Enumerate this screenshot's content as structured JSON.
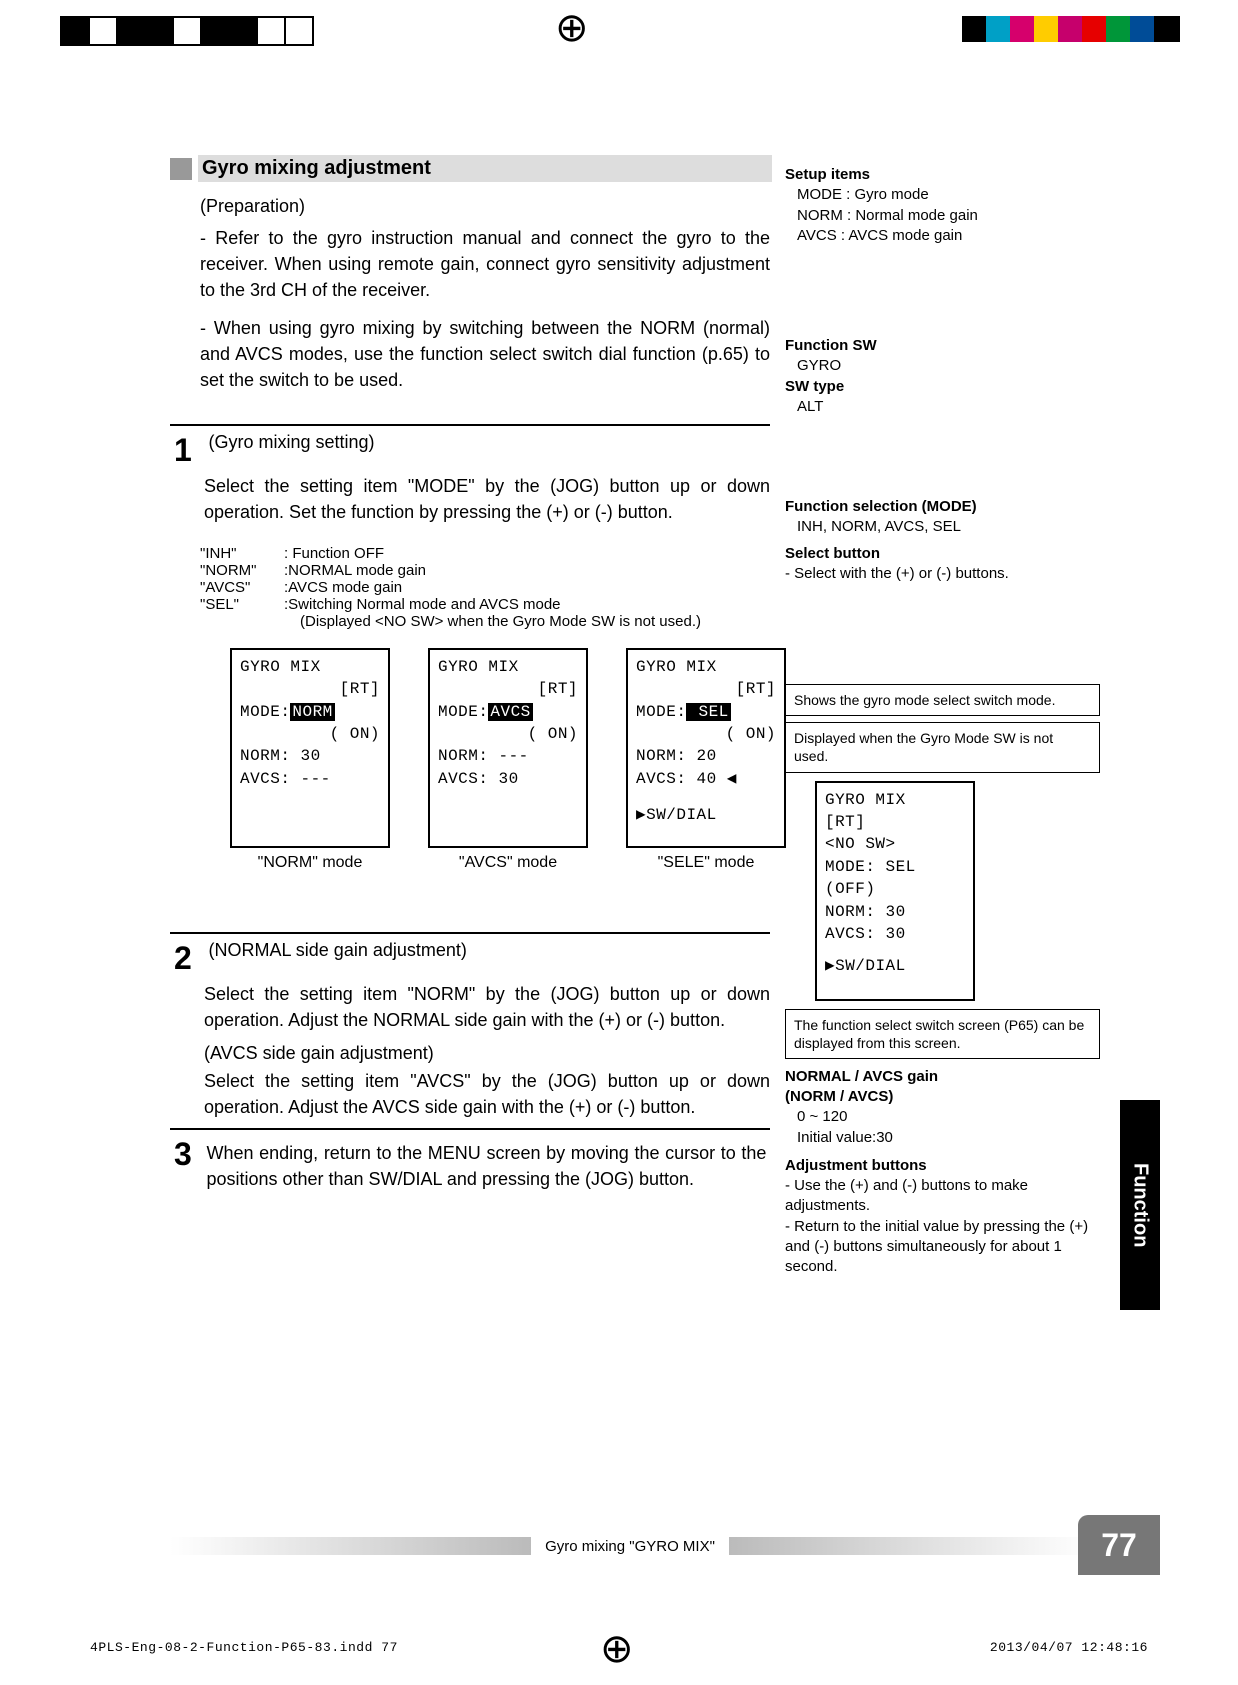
{
  "header": {
    "title": "Gyro mixing adjustment"
  },
  "prep": {
    "label": "(Preparation)",
    "p1": "- Refer to the gyro instruction manual and connect the gyro to the receiver. When using remote gain, connect gyro sensitivity adjustment to the 3rd CH of the receiver.",
    "p2": "- When using gyro mixing by switching between the NORM (normal) and AVCS modes, use the function select switch dial function (p.65) to set the switch to be used."
  },
  "step1": {
    "title": "(Gyro mixing setting)",
    "body": "Select the setting item \"MODE\" by the (JOG) button up or down operation. Set the function by pressing the (+) or (-) button."
  },
  "defs": {
    "inh_k": "\"INH\"",
    "inh_v": ": Function OFF",
    "norm_k": "\"NORM\"",
    "norm_v": ":NORMAL mode gain",
    "avcs_k": "\"AVCS\"",
    "avcs_v": ":AVCS mode gain",
    "sel_k": "\"SEL\"",
    "sel_v": ":Switching Normal mode and AVCS mode",
    "sel_note": "(Displayed <NO SW> when the Gyro Mode SW is not used.)"
  },
  "lcd": {
    "norm": {
      "l1": "GYRO MIX",
      "l2": "[RT]",
      "l3a": "MODE:",
      "l3b": "NORM",
      "l4": "( ON)",
      "l5": "NORM:  30",
      "l6": "AVCS: ---",
      "caption": "\"NORM\" mode"
    },
    "avcs": {
      "l1": "GYRO MIX",
      "l2": "[RT]",
      "l3a": "MODE:",
      "l3b": "AVCS",
      "l4": "( ON)",
      "l5": "NORM: ---",
      "l6": "AVCS:  30",
      "caption": "\"AVCS\" mode"
    },
    "sele": {
      "l1": "GYRO MIX",
      "l2": "[RT]",
      "l3a": "MODE:",
      "l3b": " SEL",
      "l4": "( ON)",
      "l5": "NORM:  20",
      "l6": "AVCS:  40 ◀",
      "l7": "▶SW/DIAL",
      "caption": "\"SELE\" mode"
    },
    "side": {
      "l1": "GYRO MIX",
      "l2": "[RT]",
      "l2b": "<NO SW>",
      "l3a": "MODE:",
      "l3b": " SEL",
      "l4": "(OFF)",
      "l5": "NORM:  30",
      "l6": "AVCS:  30",
      "l7": "▶SW/DIAL"
    }
  },
  "step2": {
    "title": "(NORMAL side gain adjustment)",
    "body1": "Select the setting item \"NORM\" by  the (JOG) button up or down operation. Adjust the NORMAL side gain with the (+) or (-) button.",
    "subtitle": "(AVCS side gain adjustment)",
    "body2": "Select the setting item \"AVCS\" by  the (JOG) button up or down operation.  Adjust the AVCS side gain with the (+) or (-) button."
  },
  "step3": {
    "body": "When ending, return to the MENU screen by moving the cursor to the positions other than SW/DIAL and pressing the (JOG) button."
  },
  "side": {
    "setup_h": "Setup items",
    "setup_mode": "MODE  : Gyro mode",
    "setup_norm": "NORM  : Normal mode gain",
    "setup_avcs": "AVCS   : AVCS mode gain",
    "fsw_h": "Function SW",
    "fsw_v": "GYRO",
    "swt_h": "SW type",
    "swt_v": "ALT",
    "fsel_h": "Function selection (MODE)",
    "fsel_v": "INH, NORM, AVCS, SEL",
    "selb_h": "Select button",
    "selb_v": "- Select with the (+) or (-) buttons.",
    "callout1": "Shows the gyro mode select switch mode.",
    "callout2": "Displayed when the Gyro Mode SW is not used.",
    "callout3": "The function select switch screen (P65) can be displayed from this screen.",
    "gain_h": "NORMAL / AVCS gain",
    "gain_h2": "(NORM / AVCS)",
    "gain_r": "0 ~ 120",
    "gain_i": "Initial value:30",
    "adj_h": "Adjustment buttons",
    "adj_1": "- Use the (+) and (-) buttons to make adjustments.",
    "adj_2": "- Return to the initial value by pressing the (+) and (-) buttons simultaneously for about 1 second."
  },
  "footer": {
    "label": "Gyro mixing \"GYRO MIX\"",
    "page": "77",
    "tab": "Function",
    "imprint_left": "4PLS-Eng-08-2-Function-P65-83.indd   77",
    "imprint_right": "2013/04/07   12:48:16"
  }
}
